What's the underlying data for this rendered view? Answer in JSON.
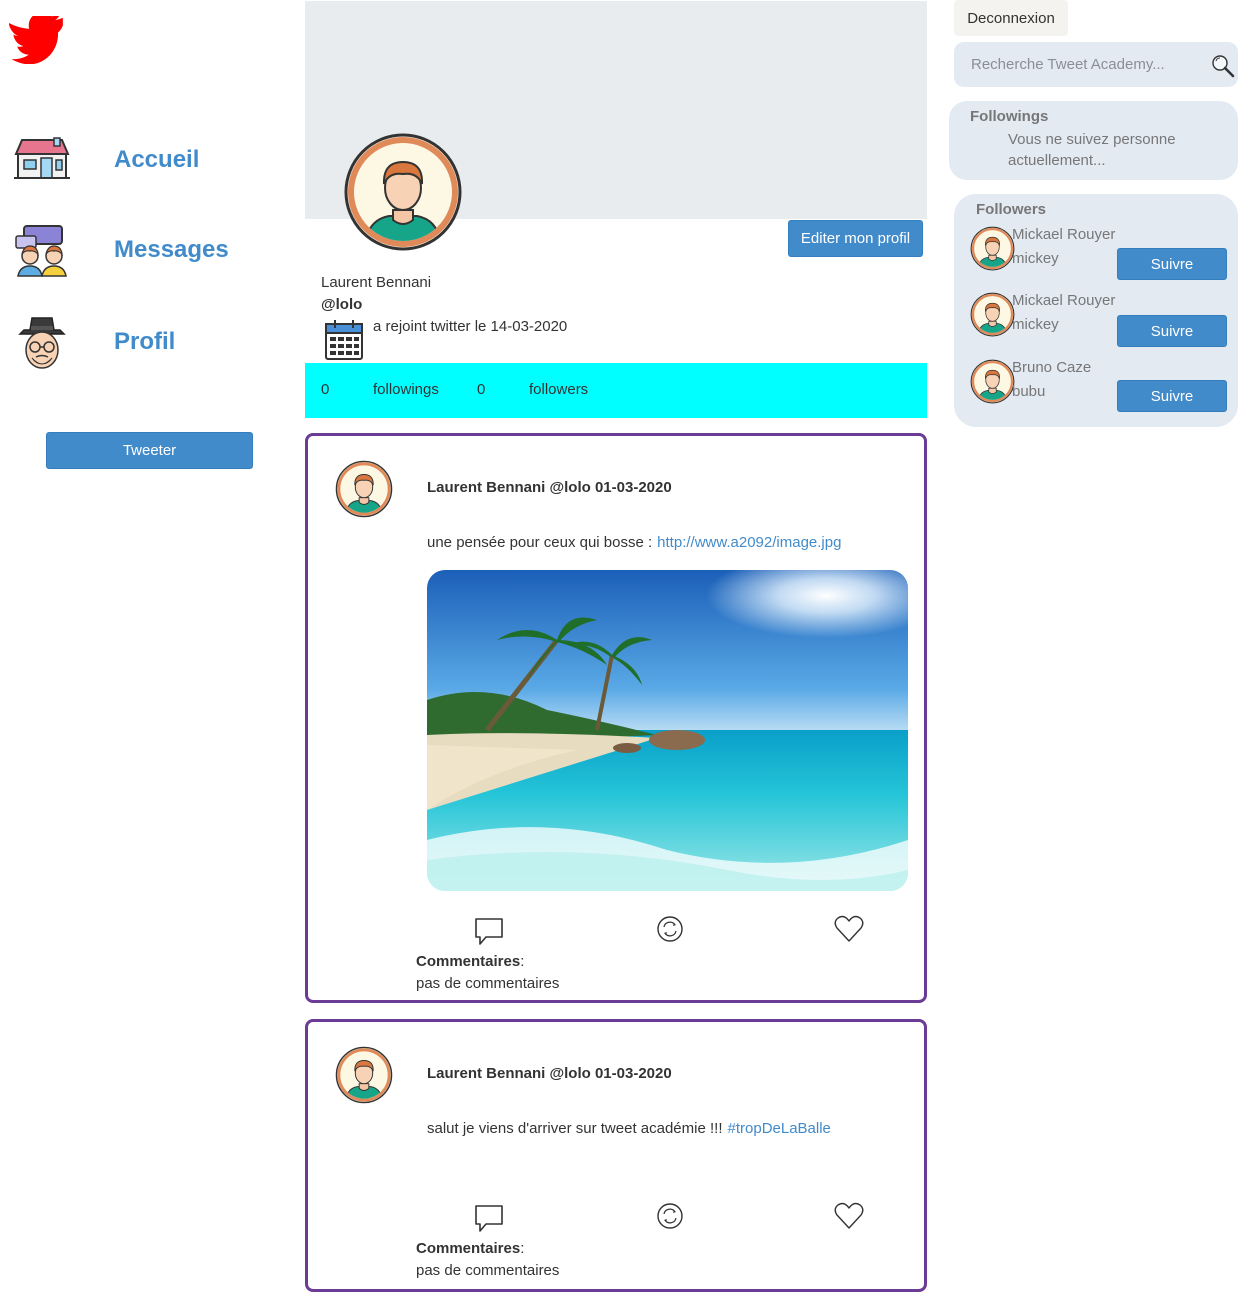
{
  "sidebar": {
    "logo_icon": "twitter-bird-icon",
    "items": [
      {
        "label": "Accueil",
        "icon": "house-icon"
      },
      {
        "label": "Messages",
        "icon": "chat-users-icon"
      },
      {
        "label": "Profil",
        "icon": "profile-face-icon"
      }
    ],
    "tweet_button": "Tweeter"
  },
  "profile": {
    "name": "Laurent Bennani",
    "handle": "@lolo",
    "joined": "a rejoint twitter le 14-03-2020",
    "edit_button": "Editer mon profil",
    "stats": {
      "followings_count": "0",
      "followings_label": "followings",
      "followers_count": "0",
      "followers_label": "followers"
    }
  },
  "tweets": [
    {
      "header": "Laurent Bennani @lolo 01-03-2020",
      "text": "une pensée pour ceux qui bosse :",
      "link": "http://www.a2092/image.jpg",
      "comments_label": "Commentaires",
      "comments_empty": "pas de commentaires"
    },
    {
      "header": "Laurent Bennani @lolo 01-03-2020",
      "text": "salut je viens d'arriver sur tweet académie !!!",
      "link": "#tropDeLaBalle",
      "comments_label": "Commentaires",
      "comments_empty": "pas de commentaires"
    }
  ],
  "header_right": {
    "logout": "Deconnexion",
    "search_placeholder": "Recherche Tweet Academy..."
  },
  "followings": {
    "title": "Followings",
    "empty": "Vous ne suivez personne actuellement..."
  },
  "followers": {
    "title": "Followers",
    "follow_label": "Suivre",
    "items": [
      {
        "name": "Mickael Rouyer",
        "handle": "mickey"
      },
      {
        "name": "Mickael Rouyer",
        "handle": "mickey"
      },
      {
        "name": "Bruno Caze",
        "handle": "bubu"
      }
    ]
  },
  "colors": {
    "accent": "#428bca",
    "stats_bar": "#00ffff",
    "tweet_border": "#6c3b96",
    "panel_bg": "#e3eaf2",
    "logo": "#ff0000"
  }
}
